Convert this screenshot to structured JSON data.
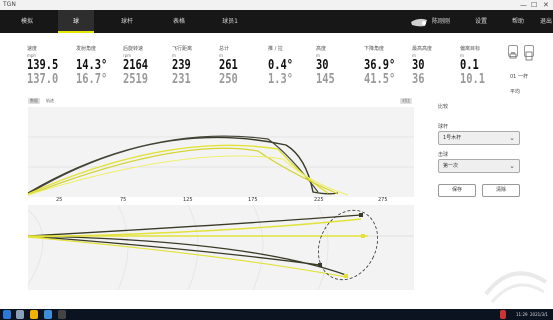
{
  "titlebar": {
    "title": "TGN",
    "controls": [
      "—",
      "☐",
      "✕"
    ]
  },
  "nav": {
    "tabs": [
      "模拟",
      "球",
      "球杆",
      "表格",
      "球员1"
    ],
    "active_index": 1,
    "right_name": "陈刚刚",
    "right_items": [
      "设置",
      "帮助",
      "退出"
    ]
  },
  "metrics": [
    {
      "label": "速度",
      "unit": "mph",
      "value": "139.5",
      "value2": "137.0"
    },
    {
      "label": "发射角度",
      "unit": "",
      "value": "14.3°",
      "value2": "16.7°"
    },
    {
      "label": "后旋转速",
      "unit": "rpm",
      "value": "2164",
      "value2": "2519"
    },
    {
      "label": "飞行距离",
      "unit": "m",
      "value": "239",
      "value2": "231"
    },
    {
      "label": "总计",
      "unit": "m",
      "value": "261",
      "value2": "250"
    },
    {
      "label": "推 / 拉",
      "unit": "",
      "value": "0.4°",
      "value2": "1.3°"
    },
    {
      "label": "高度",
      "unit": "m",
      "value": "30",
      "value2": "145"
    },
    {
      "label": "下降角度",
      "unit": "",
      "value": "36.9°",
      "value2": "41.5°"
    },
    {
      "label": "最高高度",
      "unit": "m",
      "value": "30",
      "value2": "36"
    },
    {
      "label": "偏离目标",
      "unit": "m",
      "value": "0.1",
      "value2": "10.1"
    }
  ],
  "extras": {
    "a": "01 一杆",
    "b": "平均"
  },
  "chart_tags": {
    "left1": "数据",
    "left2": "轨迹",
    "right": "对比"
  },
  "x_ticks": [
    "25",
    "75",
    "125",
    "175",
    "225",
    "275"
  ],
  "panel": {
    "title": "比较",
    "select1_label": "球杆",
    "select1_value": "1号木杆",
    "select2_label": "击球",
    "select2_value": "第一次",
    "btn_save": "保存",
    "btn_clear": "清除"
  },
  "taskbar": {
    "time": "11:29",
    "date": "2021/3/1"
  },
  "colors": {
    "nav_bg": "#171717",
    "accent": "#e6e600",
    "trace_dark": "#3a3a28",
    "trace_yellow": "#e2e23a"
  }
}
